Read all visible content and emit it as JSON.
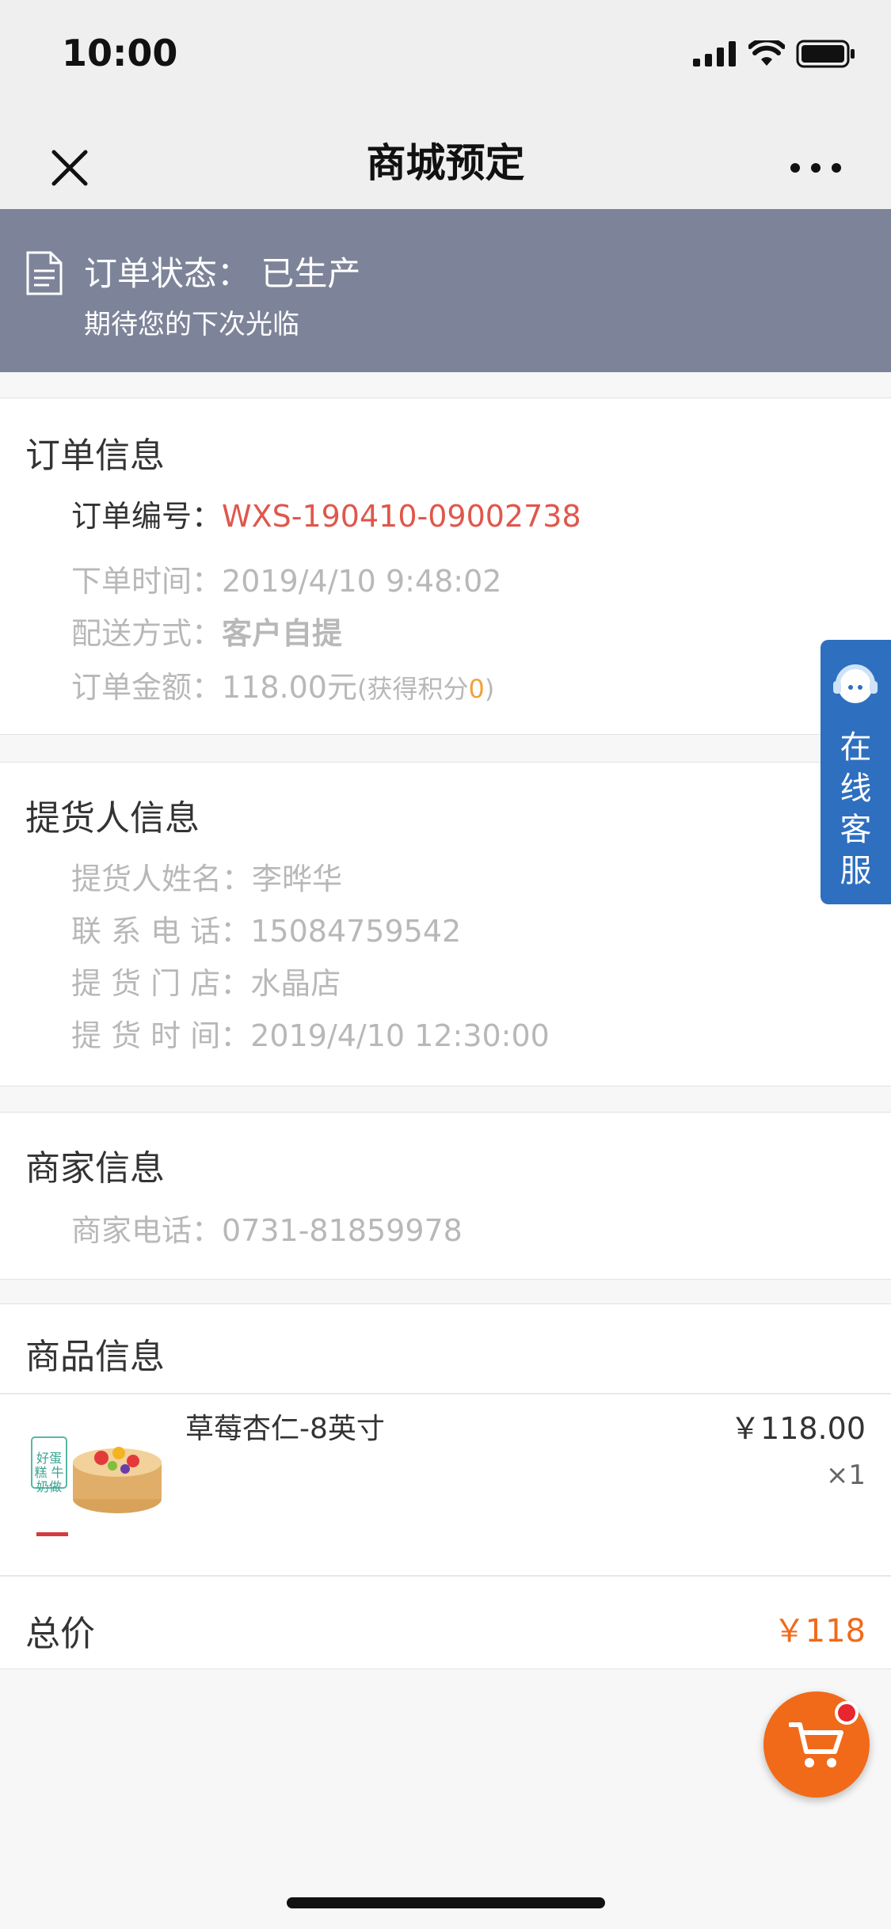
{
  "status_bar": {
    "time": "10:00"
  },
  "nav": {
    "title": "商城预定"
  },
  "order_status": {
    "text": "订单状态： 已生产",
    "subtitle": "期待您的下次光临"
  },
  "order_info": {
    "title": "订单信息",
    "order_no_label": "订单编号：",
    "order_no": "WXS-190410-09002738",
    "order_time_label": "下单时间：",
    "order_time": "2019/4/10 9:48:02",
    "delivery_label": "配送方式：",
    "delivery": "客户自提",
    "amount_label": "订单金额：",
    "amount": "118.00元",
    "points_prefix": "(获得积分",
    "points": "0",
    "points_suffix": ")"
  },
  "pickup_info": {
    "title": "提货人信息",
    "name_label": "提货人姓名：",
    "name": "李晔华",
    "phone_label": "联 系 电 话：",
    "phone": "15084759542",
    "store_label": "提 货 门 店：",
    "store": "水晶店",
    "time_label": "提 货 时 间：",
    "time": "2019/4/10 12:30:00"
  },
  "merchant_info": {
    "title": "商家信息",
    "phone_label": "商家电话：",
    "phone": "0731-81859978"
  },
  "product_info": {
    "title": "商品信息",
    "items": [
      {
        "name": "草莓杏仁-8英寸",
        "price": "￥118.00",
        "qty": "×1",
        "thumb_text": "好蛋糕 牛奶做"
      }
    ]
  },
  "total": {
    "label": "总价",
    "value": "￥118"
  },
  "service_tab": {
    "label": "在线客服"
  },
  "colors": {
    "banner": "#7d8499",
    "order_no": "#e0574c",
    "points": "#f0a23c",
    "total": "#f06a1a",
    "service": "#2e6fbf",
    "cart": "#f06a1a"
  },
  "icons": {
    "close": "close-icon",
    "more": "more-icon",
    "document": "document-icon",
    "headset": "headset-icon",
    "cart": "cart-icon"
  }
}
